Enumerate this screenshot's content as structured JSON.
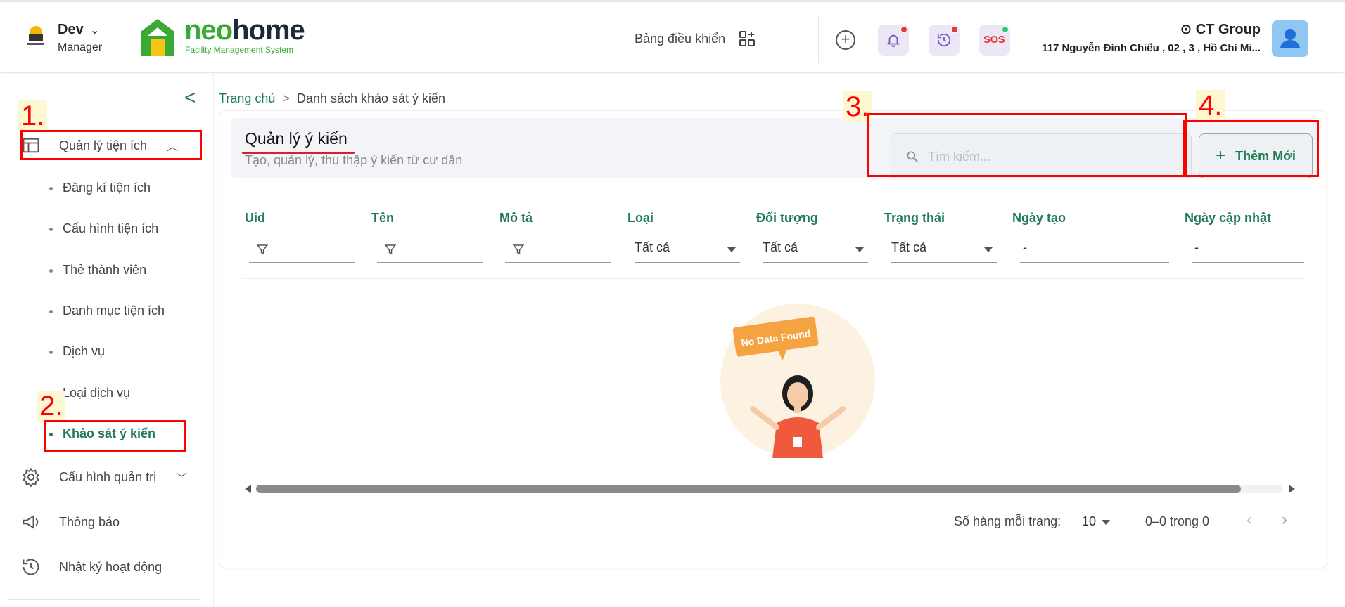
{
  "header": {
    "user_name": "Dev",
    "user_role": "Manager",
    "brand_neo": "neo",
    "brand_home": "home",
    "brand_sub": "Facility Management System",
    "dashboard_label": "Bảng điều khiển",
    "org_name": "CT Group",
    "org_address": "117 Nguyễn Đình Chiểu , 02 , 3 , Hồ Chí Mi...",
    "sos_label": "SOS",
    "icons": [
      "plus-circle-icon",
      "bell-icon",
      "history-icon",
      "sos-icon",
      "user-icon"
    ],
    "colors": {
      "brand_green": "#3aaa35",
      "dot_red": "#e53935",
      "dot_green": "#2ecc71",
      "icon_bg": "#ece6f7"
    }
  },
  "sidebar": {
    "menu": [
      {
        "label": "Quản lý tiện ích",
        "icon": "layout-icon",
        "expanded": true
      },
      {
        "label": "Cấu hình quản trị",
        "icon": "gear-icon",
        "expanded": false
      },
      {
        "label": "Thông báo",
        "icon": "megaphone-icon"
      },
      {
        "label": "Nhật ký hoạt động",
        "icon": "history-icon"
      }
    ],
    "sub_items": [
      "Đăng kí tiện ích",
      "Cấu hình tiện ích",
      "Thẻ thành viên",
      "Danh mục tiện ích",
      "Dịch vụ",
      "Loại dịch vụ",
      "Khảo sát ý kiến"
    ],
    "active_sub_item": "Khảo sát ý kiến"
  },
  "breadcrumb": {
    "home": "Trang chủ",
    "separator": ">",
    "current": "Danh sách khảo sát ý kiến"
  },
  "page": {
    "title": "Quản lý ý kiến",
    "subtitle": "Tạo, quản lý, thu thập ý kiến từ cư dân",
    "search_placeholder": "Tìm kiếm...",
    "add_button": "Thêm Mới"
  },
  "table": {
    "columns": [
      "Uid",
      "Tên",
      "Mô tả",
      "Loại",
      "Đối tượng",
      "Trạng thái",
      "Ngày tạo",
      "Ngày cập nhật"
    ],
    "filters": {
      "select_default": "Tất cả",
      "date_default": "-"
    },
    "empty_text": "No Data Found"
  },
  "pagination": {
    "rows_label": "Số hàng mỗi trang:",
    "rows_value": "10",
    "range": "0–0 trong 0"
  },
  "annotations": [
    "1.",
    "2.",
    "3.",
    "4."
  ]
}
